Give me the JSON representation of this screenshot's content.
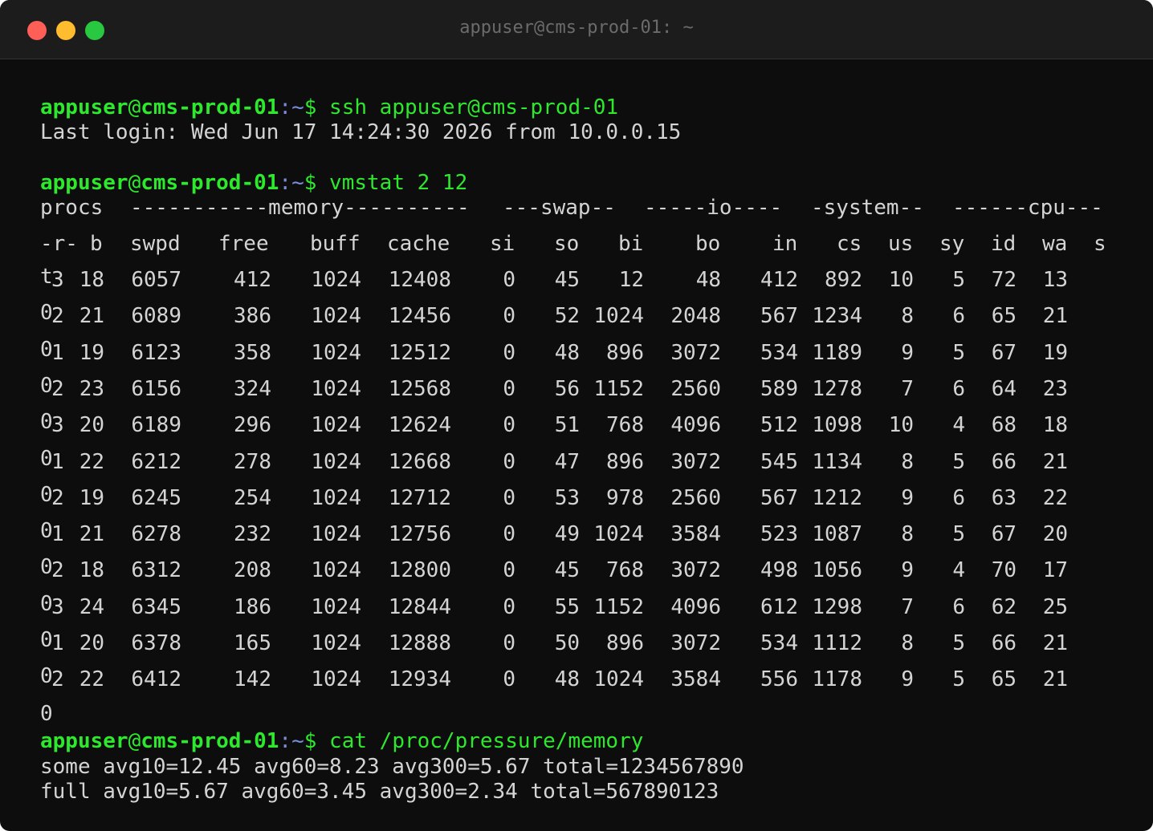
{
  "window": {
    "title": "appuser@cms-prod-01: ~"
  },
  "prompt": {
    "user": "appuser",
    "at": "@",
    "host": "cms-prod-01",
    "sep": ":",
    "path": "~",
    "dollar": "$"
  },
  "session": {
    "cmd1": "ssh appuser@cms-prod-01",
    "last_login": "Last login: Wed Jun 17 14:24:30 2026 from 10.0.0.15",
    "cmd2": "vmstat 2 12",
    "cmd3": "cat /proc/pressure/memory",
    "pressure_some": "some avg10=12.45 avg60=8.23 avg300=5.67 total=1234567890",
    "pressure_full": "full avg10=5.67 avg60=3.45 avg300=2.34 total=567890123"
  },
  "vmstat": {
    "group_headers": [
      "procs",
      "-----------memory----------",
      "---swap--",
      "-----io----",
      "-system--",
      "------cpu---"
    ],
    "column_headers": [
      "-r-",
      "b",
      "swpd",
      "free",
      "buff",
      "cache",
      "si",
      "so",
      "bi",
      "bo",
      "in",
      "cs",
      "us",
      "sy",
      "id",
      "wa",
      "s"
    ],
    "rows": [
      [
        "t",
        "3",
        "18",
        "6057",
        "412",
        "1024",
        "12408",
        "0",
        "45",
        "12",
        "48",
        "412",
        "892",
        "10",
        "5",
        "72",
        "13"
      ],
      [
        "0",
        "2",
        "21",
        "6089",
        "386",
        "1024",
        "12456",
        "0",
        "52",
        "1024",
        "2048",
        "567",
        "1234",
        "8",
        "6",
        "65",
        "21"
      ],
      [
        "0",
        "1",
        "19",
        "6123",
        "358",
        "1024",
        "12512",
        "0",
        "48",
        "896",
        "3072",
        "534",
        "1189",
        "9",
        "5",
        "67",
        "19"
      ],
      [
        "0",
        "2",
        "23",
        "6156",
        "324",
        "1024",
        "12568",
        "0",
        "56",
        "1152",
        "2560",
        "589",
        "1278",
        "7",
        "6",
        "64",
        "23"
      ],
      [
        "0",
        "3",
        "20",
        "6189",
        "296",
        "1024",
        "12624",
        "0",
        "51",
        "768",
        "4096",
        "512",
        "1098",
        "10",
        "4",
        "68",
        "18"
      ],
      [
        "0",
        "1",
        "22",
        "6212",
        "278",
        "1024",
        "12668",
        "0",
        "47",
        "896",
        "3072",
        "545",
        "1134",
        "8",
        "5",
        "66",
        "21"
      ],
      [
        "0",
        "2",
        "19",
        "6245",
        "254",
        "1024",
        "12712",
        "0",
        "53",
        "978",
        "2560",
        "567",
        "1212",
        "9",
        "6",
        "63",
        "22"
      ],
      [
        "0",
        "1",
        "21",
        "6278",
        "232",
        "1024",
        "12756",
        "0",
        "49",
        "1024",
        "3584",
        "523",
        "1087",
        "8",
        "5",
        "67",
        "20"
      ],
      [
        "0",
        "2",
        "18",
        "6312",
        "208",
        "1024",
        "12800",
        "0",
        "45",
        "768",
        "3072",
        "498",
        "1056",
        "9",
        "4",
        "70",
        "17"
      ],
      [
        "0",
        "3",
        "24",
        "6345",
        "186",
        "1024",
        "12844",
        "0",
        "55",
        "1152",
        "4096",
        "612",
        "1298",
        "7",
        "6",
        "62",
        "25"
      ],
      [
        "0",
        "1",
        "20",
        "6378",
        "165",
        "1024",
        "12888",
        "0",
        "50",
        "896",
        "3072",
        "534",
        "1112",
        "8",
        "5",
        "66",
        "21"
      ],
      [
        "0",
        "2",
        "22",
        "6412",
        "142",
        "1024",
        "12934",
        "0",
        "48",
        "1024",
        "3584",
        "556",
        "1178",
        "9",
        "5",
        "65",
        "21"
      ]
    ],
    "trailing": "0"
  }
}
